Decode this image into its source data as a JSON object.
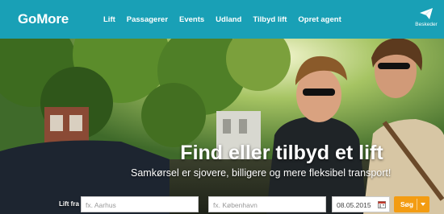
{
  "header": {
    "logo": "GoMore",
    "nav": [
      {
        "label": "Lift"
      },
      {
        "label": "Passagerer"
      },
      {
        "label": "Events"
      },
      {
        "label": "Udland"
      },
      {
        "label": "Tilbyd lift"
      },
      {
        "label": "Opret agent"
      }
    ],
    "messages_label": "Beskeder",
    "messages_icon": "paper-plane-icon"
  },
  "hero": {
    "headline": "Find eller tilbyd et lift",
    "subline": "Samkørsel er sjovere, billigere og mere fleksibel transport!"
  },
  "search": {
    "label": "Lift fra",
    "from_placeholder": "fx. Aarhus",
    "to_placeholder": "fx. København",
    "date_value": "08.05.2015",
    "calendar_icon": "calendar-icon",
    "button_label": "Søg"
  },
  "colors": {
    "brand": "#19a0b6",
    "search_button": "#f39c12"
  }
}
